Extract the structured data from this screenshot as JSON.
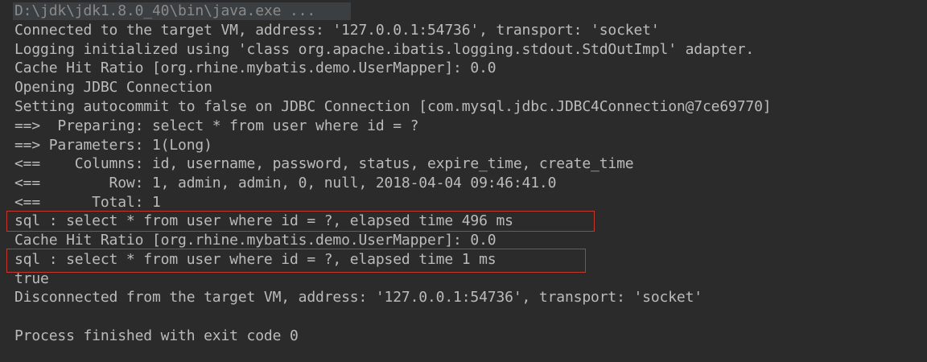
{
  "console": {
    "command_line": "D:\\jdk\\jdk1.8.0_40\\bin\\java.exe ...",
    "lines": [
      "Connected to the target VM, address: '127.0.0.1:54736', transport: 'socket'",
      "Logging initialized using 'class org.apache.ibatis.logging.stdout.StdOutImpl' adapter.",
      "Cache Hit Ratio [org.rhine.mybatis.demo.UserMapper]: 0.0",
      "Opening JDBC Connection",
      "Setting autocommit to false on JDBC Connection [com.mysql.jdbc.JDBC4Connection@7ce69770]",
      "==>  Preparing: select * from user where id = ? ",
      "==> Parameters: 1(Long)",
      "<==    Columns: id, username, password, status, expire_time, create_time",
      "<==        Row: 1, admin, admin, 0, null, 2018-04-04 09:46:41.0",
      "<==      Total: 1",
      "sql : select * from user where id = ?, elapsed time 496 ms",
      "Cache Hit Ratio [org.rhine.mybatis.demo.UserMapper]: 0.0",
      "sql : select * from user where id = ?, elapsed time 1 ms",
      "true",
      "Disconnected from the target VM, address: '127.0.0.1:54736', transport: 'socket'",
      "",
      "Process finished with exit code 0"
    ]
  },
  "colors": {
    "background": "#2b2b2b",
    "text": "#bbbbbb",
    "command_text": "#8a8a8a",
    "highlight_border": "#c0392b"
  }
}
